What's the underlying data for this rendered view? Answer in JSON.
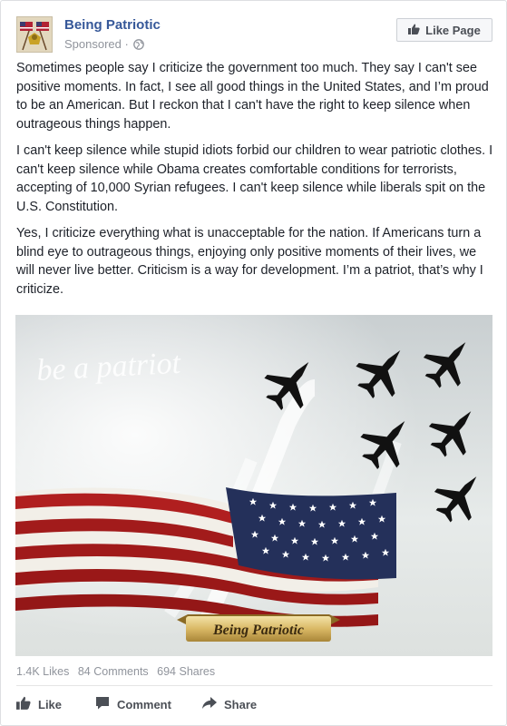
{
  "post": {
    "page_name": "Being Patriotic",
    "sponsored_label": "Sponsored",
    "separator": "·",
    "like_page_label": "Like Page",
    "paragraphs": [
      "Sometimes people say I criticize the government too much. They say I can't see positive moments. In fact, I see all good things in the United States, and I’m proud to be an American. But I reckon that I can't have the right to keep silence when outrageous things happen.",
      "I can't keep silence while stupid idiots forbid our children to wear patriotic clothes. I can't keep silence while Obama creates comfortable conditions for terrorists, accepting of 10,000 Syrian refugees. I can't keep silence while liberals spit on the U.S. Constitution.",
      "Yes, I criticize everything what is unacceptable for the nation. If Americans turn a blind eye to outrageous things, enjoying only positive moments of their lives, we will never live better. Criticism is a way for development. I’m a patriot, that’s why I criticize."
    ],
    "image": {
      "watermark_text": "be a patriot",
      "banner_text": "Being Patriotic"
    },
    "stats": {
      "likes": "1.4K Likes",
      "comments": "84 Comments",
      "shares": "694 Shares"
    },
    "actions": {
      "like": "Like",
      "comment": "Comment",
      "share": "Share"
    }
  },
  "colors": {
    "page_name": "#365899",
    "meta": "#90949c",
    "text": "#1d2129",
    "action": "#4b4f56"
  },
  "icons": [
    "globe-icon",
    "thumbs-up-icon",
    "comment-icon",
    "share-icon"
  ]
}
